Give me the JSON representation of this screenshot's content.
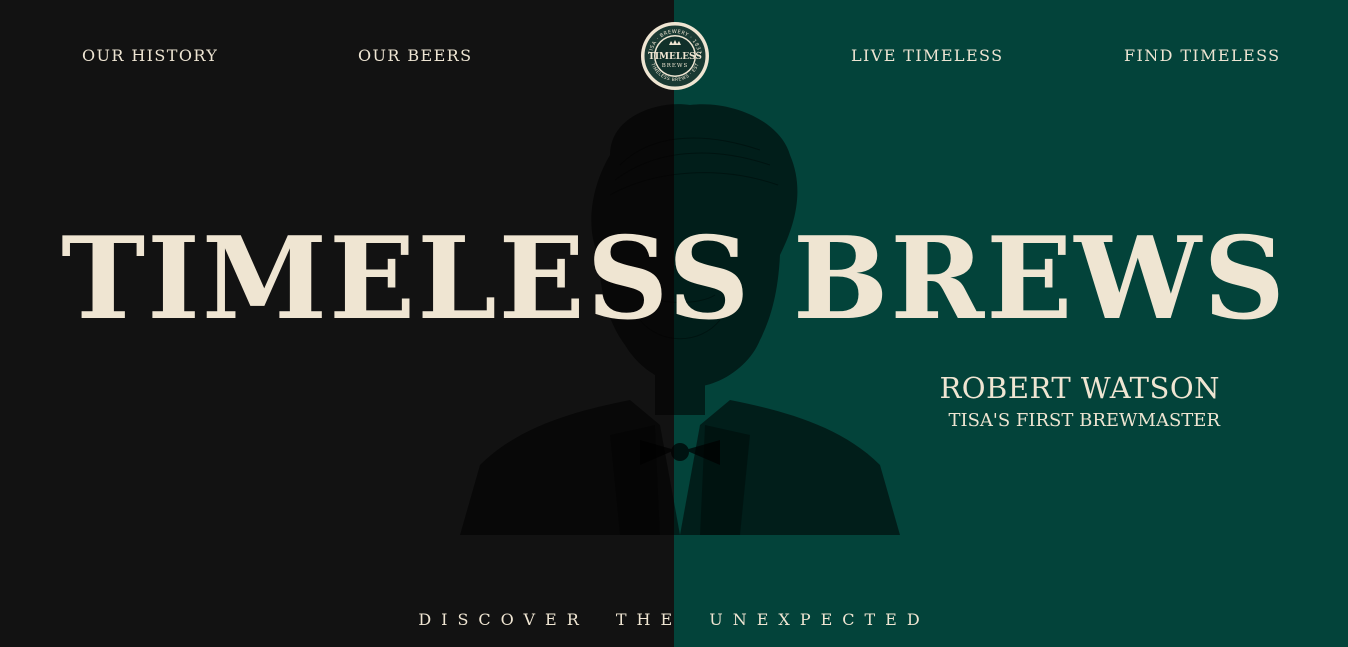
{
  "nav": {
    "items": [
      {
        "label": "OUR HISTORY"
      },
      {
        "label": "OUR BEERS"
      },
      {
        "label": "LIVE TIMELESS"
      },
      {
        "label": "FIND TIMELESS"
      }
    ]
  },
  "logo": {
    "main": "TIMELESS",
    "sub": "BREWS",
    "ring_top": "TISA · BREWERY · 1837",
    "ring_bottom": "TIMELESS BREWS · EST"
  },
  "hero": {
    "title": "TIMELESS BREWS"
  },
  "caption": {
    "name": "ROBERT WATSON",
    "role": "TISA'S FIRST BREWMASTER"
  },
  "tagline": "DISCOVER THE UNEXPECTED",
  "colors": {
    "left_bg": "#121212",
    "right_bg": "#03433a",
    "cream": "#efe5d2",
    "portrait_ink": "#0b0b0b"
  }
}
